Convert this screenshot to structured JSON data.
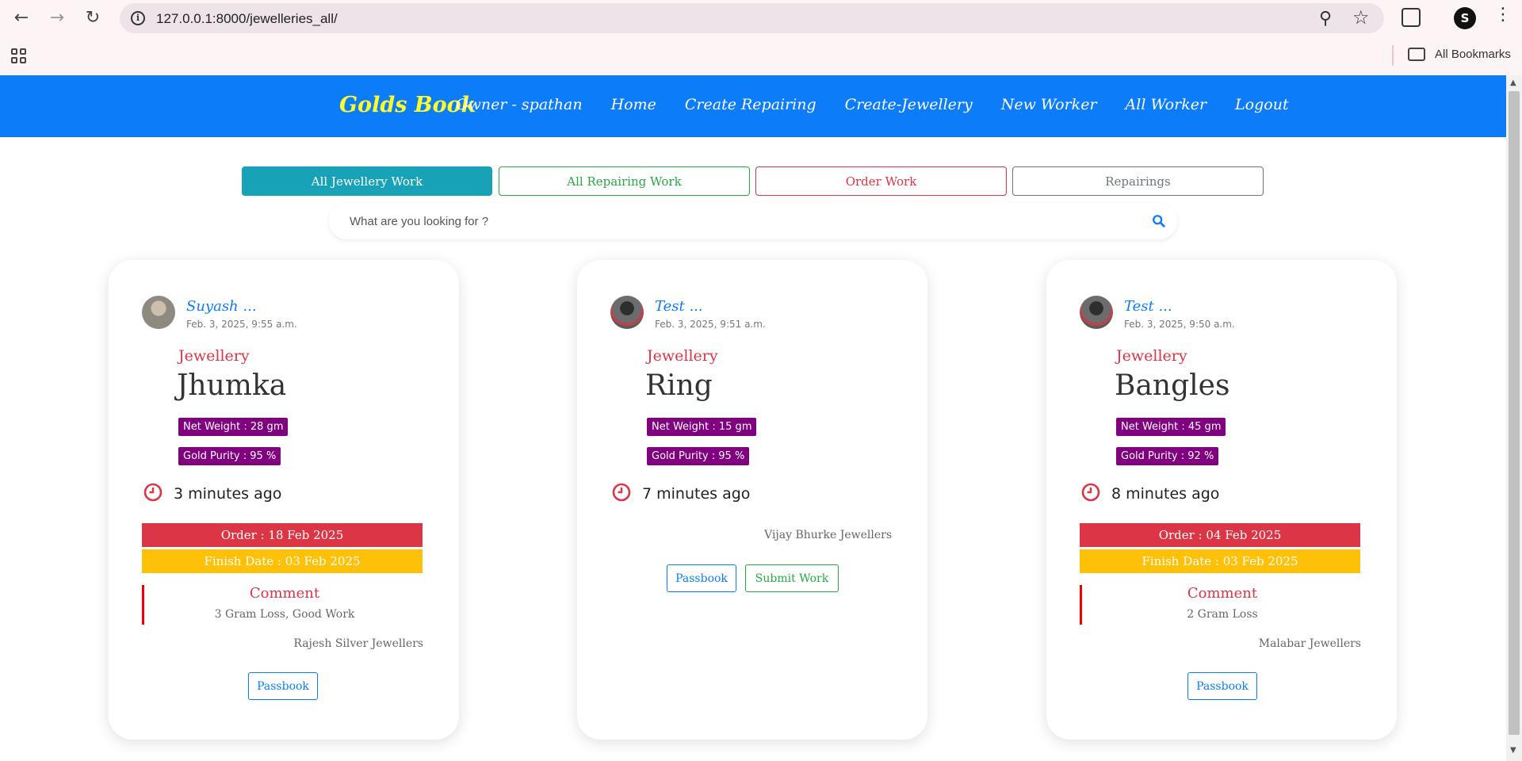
{
  "browser": {
    "url": "127.0.0.1:8000/jewelleries_all/",
    "bookmarks_label": "All Bookmarks",
    "profile_initial": "S"
  },
  "navbar": {
    "brand": "Golds Book",
    "links": [
      "Owner - spathan",
      "Home",
      "Create Repairing",
      "Create-Jewellery",
      "New Worker",
      "All Worker",
      "Logout"
    ]
  },
  "filters": {
    "all_jewellery": "All Jewellery Work",
    "all_repairing": "All Repairing Work",
    "order_work": "Order Work",
    "repairings": "Repairings"
  },
  "search": {
    "placeholder": "What are you looking for ?"
  },
  "colors": {
    "navbar": "#0d7cf8",
    "brand": "#ffff2a",
    "teal": "#17a2b8",
    "green": "#28a745",
    "red": "#dc3545",
    "yellow": "#ffc107",
    "badge": "#800080"
  },
  "cards": [
    {
      "owner": "Suyash ...",
      "date": "Feb. 3, 2025, 9:55 a.m.",
      "category": "Jewellery",
      "name": "Jhumka",
      "net_weight": "Net Weight : 28 gm",
      "gold_purity": "Gold Purity : 95 %",
      "time_ago": "3 minutes ago",
      "order": "Order : 18 Feb 2025",
      "finish": "Finish Date : 03 Feb 2025",
      "comment_title": "Comment",
      "comment": "3 Gram Loss, Good Work",
      "shop": "Rajesh Silver Jewellers",
      "passbook": "Passbook"
    },
    {
      "owner": "Test ...",
      "date": "Feb. 3, 2025, 9:51 a.m.",
      "category": "Jewellery",
      "name": "Ring",
      "net_weight": "Net Weight : 15 gm",
      "gold_purity": "Gold Purity : 95 %",
      "time_ago": "7 minutes ago",
      "shop": "Vijay Bhurke Jewellers",
      "passbook": "Passbook",
      "submit": "Submit Work"
    },
    {
      "owner": "Test ...",
      "date": "Feb. 3, 2025, 9:50 a.m.",
      "category": "Jewellery",
      "name": "Bangles",
      "net_weight": "Net Weight : 45 gm",
      "gold_purity": "Gold Purity : 92 %",
      "time_ago": "8 minutes ago",
      "order": "Order : 04 Feb 2025",
      "finish": "Finish Date : 03 Feb 2025",
      "comment_title": "Comment",
      "comment": "2 Gram Loss",
      "shop": "Malabar Jewellers",
      "passbook": "Passbook"
    }
  ]
}
